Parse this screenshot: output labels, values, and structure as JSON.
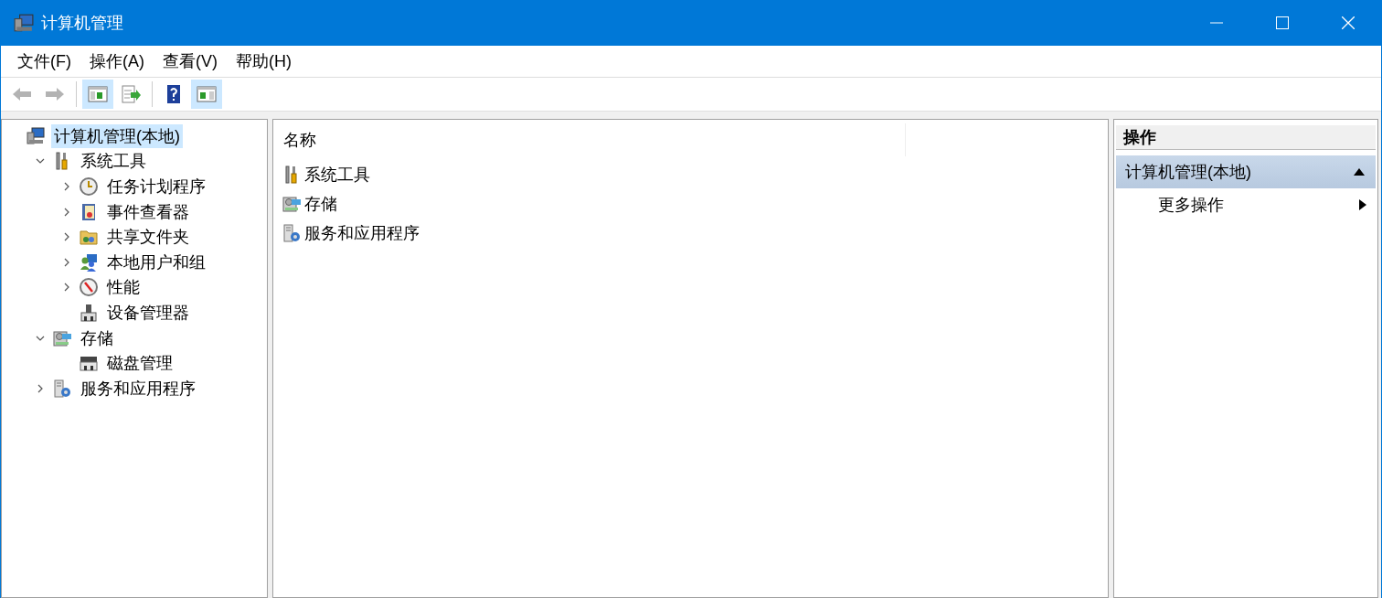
{
  "window": {
    "title": "计算机管理"
  },
  "menu": [
    "文件(F)",
    "操作(A)",
    "查看(V)",
    "帮助(H)"
  ],
  "toolbar": [
    {
      "kind": "back",
      "disabled": true,
      "on": false
    },
    {
      "kind": "forward",
      "disabled": true,
      "on": false
    },
    {
      "kind": "tree",
      "disabled": false,
      "on": true
    },
    {
      "kind": "export",
      "disabled": false,
      "on": false
    },
    {
      "kind": "help",
      "disabled": false,
      "on": false
    },
    {
      "kind": "actions",
      "disabled": false,
      "on": true
    }
  ],
  "tree": [
    {
      "label": "计算机管理(本地)",
      "selected": true,
      "children": [
        {
          "label": "系统工具",
          "expanded": true,
          "selected": false,
          "children": [
            {
              "label": "任务计划程序",
              "expanded": false,
              "selected": false
            },
            {
              "label": "事件查看器",
              "expanded": false,
              "selected": false
            },
            {
              "label": "共享文件夹",
              "expanded": false,
              "selected": false
            },
            {
              "label": "本地用户和组",
              "expanded": false,
              "selected": false
            },
            {
              "label": "性能",
              "expanded": false,
              "selected": false
            },
            {
              "label": "设备管理器",
              "selected": false
            }
          ]
        },
        {
          "label": "存储",
          "expanded": true,
          "selected": false,
          "children": [
            {
              "label": "磁盘管理",
              "selected": false
            }
          ]
        },
        {
          "label": "服务和应用程序",
          "expanded": false,
          "selected": false
        }
      ]
    }
  ],
  "list": {
    "columns": [
      "名称"
    ],
    "rows": [
      "系统工具",
      "存储",
      "服务和应用程序"
    ]
  },
  "actions": {
    "title": "操作",
    "section": "计算机管理(本地)",
    "items": [
      "更多操作"
    ]
  }
}
